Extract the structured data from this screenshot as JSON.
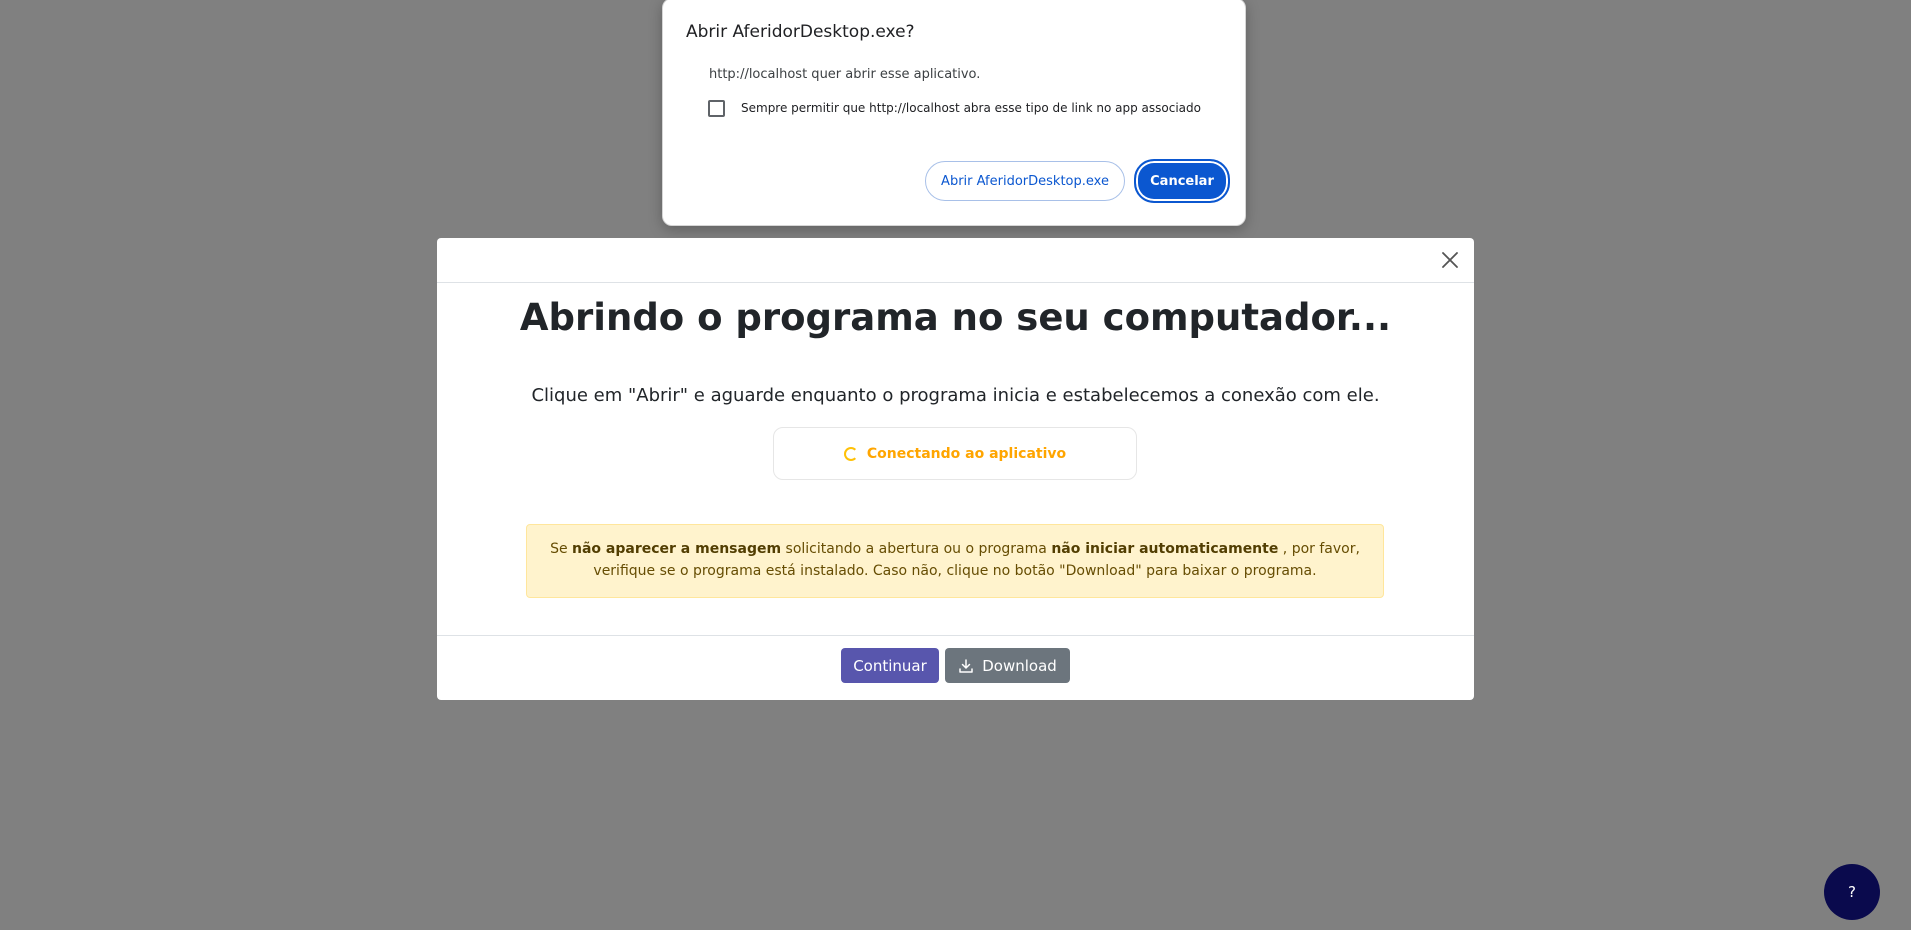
{
  "protocol_dialog": {
    "title": "Abrir AferidorDesktop.exe?",
    "message": "http://localhost quer abrir esse aplicativo.",
    "checkbox_label": "Sempre permitir que http://localhost abra esse tipo de link no app associado",
    "checkbox_checked": false,
    "open_button": "Abrir AferidorDesktop.exe",
    "cancel_button": "Cancelar"
  },
  "modal": {
    "title": "Abrindo o programa no seu computador...",
    "subtitle": "Clique em \"Abrir\" e aguarde enquanto o programa inicia e estabelecemos a conexão com ele.",
    "status": {
      "text": "Conectando ao aplicativo",
      "color": "#ffa500"
    },
    "warning": {
      "part1": "Se ",
      "bold1": "não aparecer a mensagem",
      "part2": " solicitando a abertura ou o programa ",
      "bold2": "não iniciar automaticamente",
      "part3": " , por favor, verifique se o programa está instalado. Caso não, clique no botão \"Download\" para baixar o programa."
    },
    "buttons": {
      "continue": "Continuar",
      "download": "Download"
    }
  },
  "help_button": {
    "label": "?"
  },
  "colors": {
    "backdrop": "#808080",
    "primary_button": "#5856ad",
    "secondary_button": "#6c757d",
    "browser_accent": "#0b57d0",
    "help_button": "#0a0a4d"
  },
  "icons": [
    "close-icon",
    "spinner-icon",
    "download-icon",
    "checkbox-icon"
  ]
}
